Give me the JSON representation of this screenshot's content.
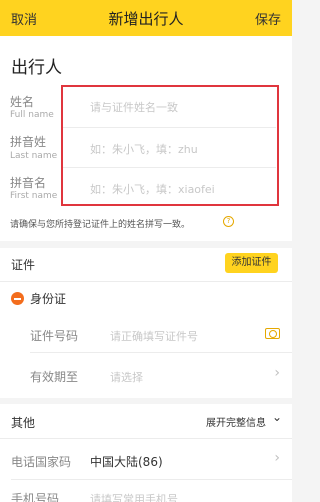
{
  "header": {
    "cancel": "取消",
    "title": "新增出行人",
    "save": "保存"
  },
  "traveler": {
    "section_title": "出行人",
    "fields": [
      {
        "label": "姓名",
        "sub": "Full name",
        "placeholder": "请与证件姓名一致"
      },
      {
        "label": "拼音姓",
        "sub": "Last name",
        "placeholder": "如：朱小飞，填：zhu"
      },
      {
        "label": "拼音名",
        "sub": "First name",
        "placeholder": "如：朱小飞，填：xiaofei"
      }
    ],
    "hint": "请确保与您所持登记证件上的姓名拼写一致。",
    "hint_icon": "?"
  },
  "documents": {
    "title": "证件",
    "add_button": "添加证件",
    "id_card": {
      "title": "身份证",
      "number_label": "证件号码",
      "number_placeholder": "请正确填写证件号",
      "expiry_label": "有效期至",
      "expiry_placeholder": "请选择"
    }
  },
  "other": {
    "title": "其他",
    "expand": "展开完整信息",
    "country_label": "电话国家码",
    "country_value": "中国大陆(86)",
    "phone_label": "手机号码",
    "phone_placeholder": "请填写常用手机号"
  },
  "colors": {
    "accent": "#ffd31f",
    "highlight": "#e0353d",
    "minus": "#f36d1d"
  }
}
